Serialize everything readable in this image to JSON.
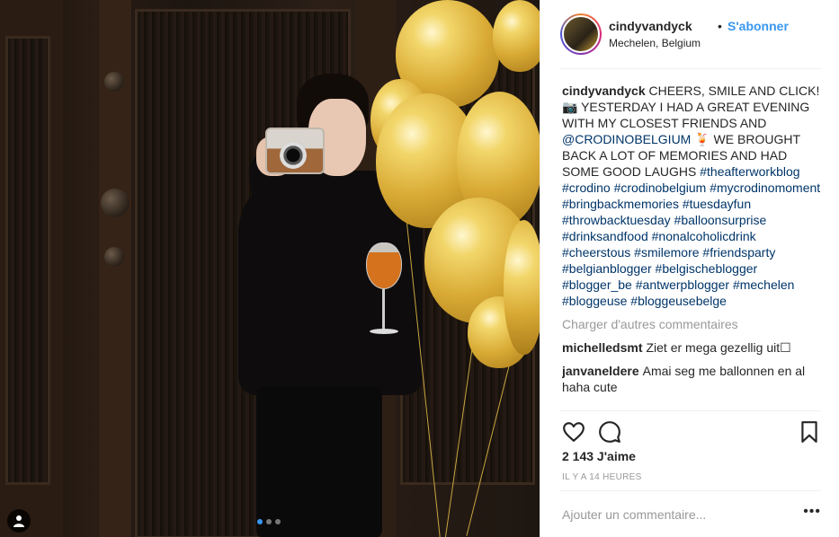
{
  "post": {
    "username": "cindyvandyck",
    "separator": "•",
    "follow_label": "S'abonner",
    "location": "Mechelen, Belgium"
  },
  "caption": {
    "username": "cindyvandyck",
    "text_part1": "CHEERS, SMILE AND CLICK! 📷 YESTERDAY I HAD A GREAT EVENING WITH MY CLOSEST FRIENDS AND",
    "mention": "@CRODINOBELGIUM",
    "text_part2": "🍹 WE BROUGHT BACK A LOT OF MEMORIES AND HAD SOME GOOD LAUGHS",
    "hashtags": [
      "#theafterworkblog",
      "#crodino",
      "#crodinobelgium",
      "#mycrodinomoment",
      "#bringbackmemories",
      "#tuesdayfun",
      "#throwbacktuesday",
      "#balloonsurprise",
      "#drinksandfood",
      "#nonalcoholicdrink",
      "#cheerstous",
      "#smilemore",
      "#friendsparty",
      "#belgianblogger",
      "#belgischeblogger",
      "#blogger_be",
      "#antwerpblogger",
      "#mechelen",
      "#bloggeuse",
      "#bloggeusebelge"
    ]
  },
  "load_more_label": "Charger d'autres commentaires",
  "comments": [
    {
      "user": "michelledsmt",
      "text": "Ziet er mega gezellig uit☐"
    },
    {
      "user": "janvaneldere",
      "text": "Amai seg me ballonnen en al haha cute"
    }
  ],
  "likes_label": "2 143 J'aime",
  "time_label": "IL Y A 14 HEURES",
  "add_comment_placeholder": "Ajouter un commentaire...",
  "more_options_label": "•••",
  "carousel": {
    "count": 3,
    "active_index": 0
  },
  "icons": {
    "like": "heart-icon",
    "comment": "comment-icon",
    "save": "bookmark-icon",
    "user_tag": "user-tag-icon"
  },
  "colors": {
    "link_blue": "#3897f0",
    "hashtag": "#003569",
    "muted": "#999999",
    "text": "#262626",
    "border": "#efefef"
  }
}
